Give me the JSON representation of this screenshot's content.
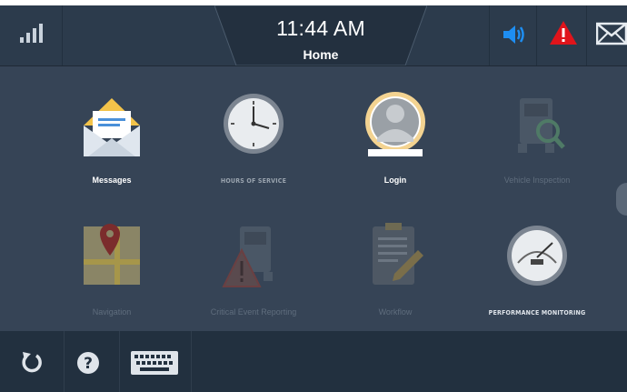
{
  "header": {
    "time": "11:44 AM",
    "screen_title": "Home",
    "icons": [
      "signal-strength-icon",
      "speaker-icon",
      "alert-icon",
      "mail-icon"
    ],
    "colors": {
      "speaker": "#1e8ef2",
      "alert": "#e0141b"
    }
  },
  "apps": [
    {
      "label": "Messages",
      "icon": "envelope-icon",
      "enabled": true
    },
    {
      "label": "HOURS OF SERVICE",
      "icon": "clock-icon",
      "enabled": true
    },
    {
      "label": "Login",
      "icon": "user-icon",
      "enabled": true
    },
    {
      "label": "Vehicle Inspection",
      "icon": "truck-inspection-icon",
      "enabled": false
    },
    {
      "label": "Navigation",
      "icon": "map-pin-icon",
      "enabled": false
    },
    {
      "label": "Critical Event Reporting",
      "icon": "truck-warning-icon",
      "enabled": false
    },
    {
      "label": "Workflow",
      "icon": "clipboard-icon",
      "enabled": false
    },
    {
      "label": "PERFORMANCE MONITORING",
      "icon": "gauge-icon",
      "enabled": true
    }
  ],
  "footer": {
    "buttons": [
      "refresh-icon",
      "help-icon",
      "keyboard-icon"
    ]
  }
}
